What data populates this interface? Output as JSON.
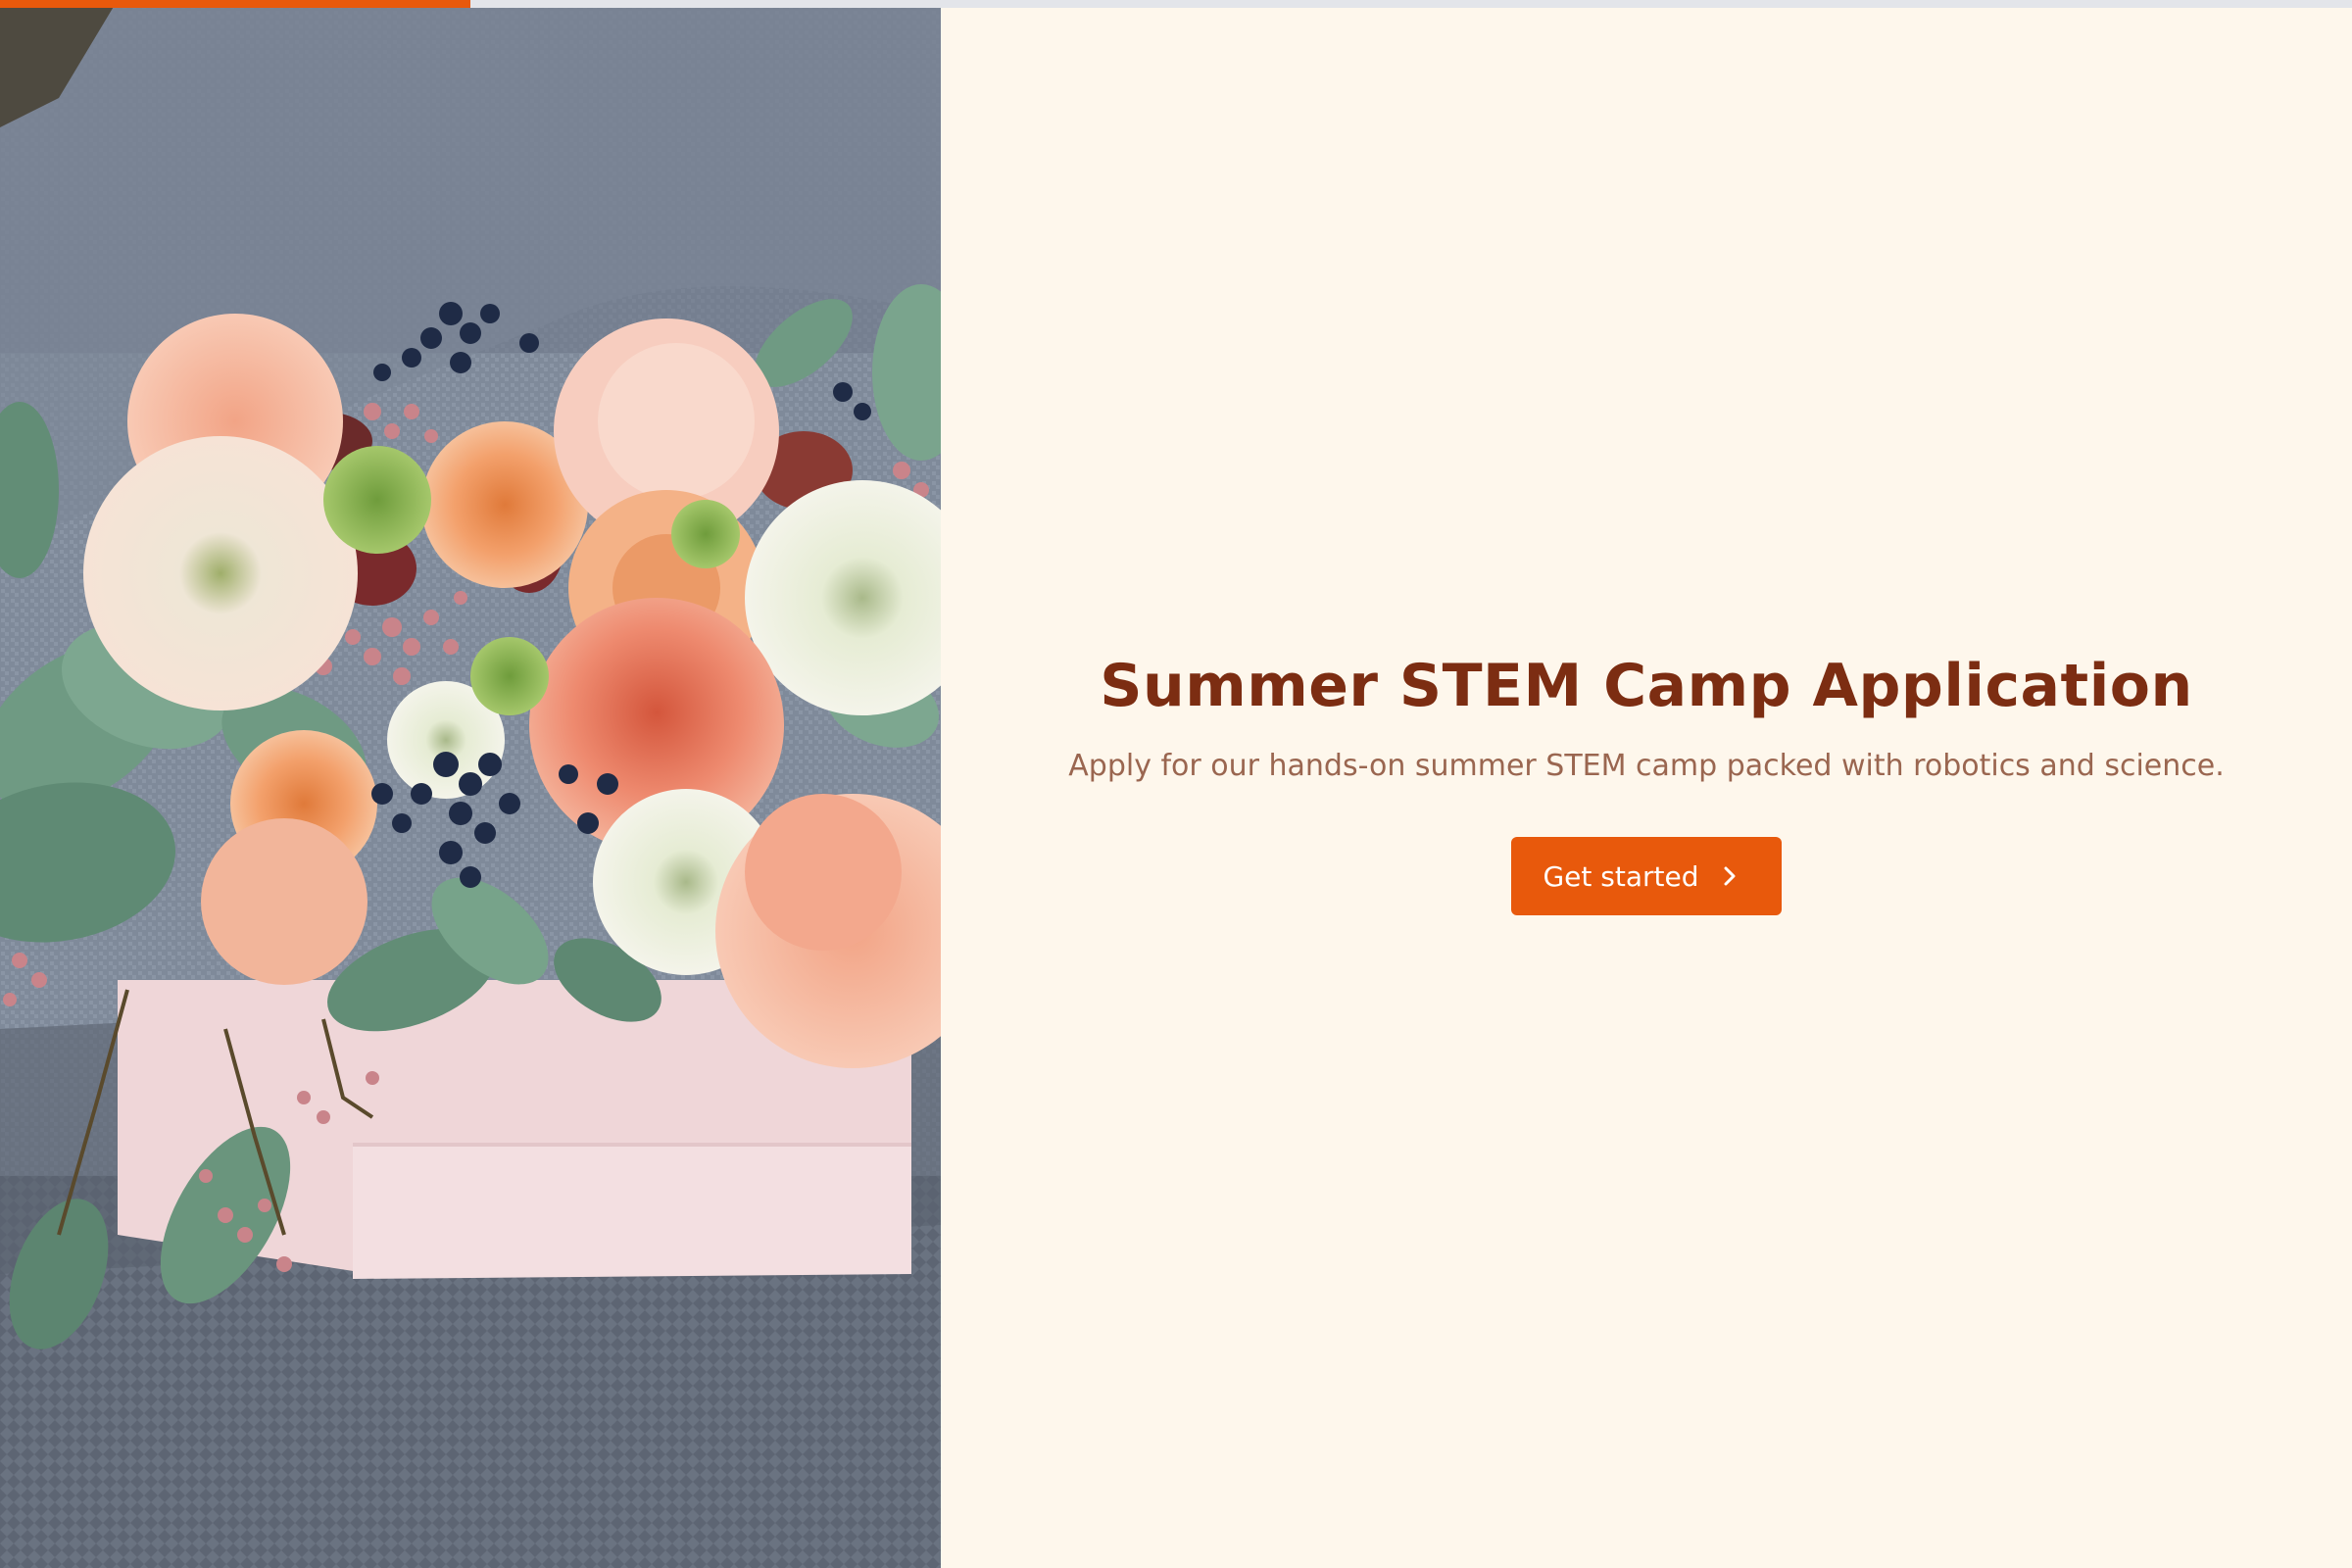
{
  "progress": {
    "fraction": 0.2
  },
  "hero_image": {
    "alt": "Flower arrangement in a pink box"
  },
  "intro": {
    "title": "Summer STEM Camp Application",
    "description": "Apply for our hands-on summer STEM camp packed with robotics and science.",
    "start_button_label": "Get started",
    "start_button_icon": "chevron-right-icon"
  },
  "colors": {
    "accent": "#e8590c",
    "title": "#7c2d12",
    "subtitle": "#9a6650",
    "background": "#fef7ec",
    "progress_track": "#e3e5ea"
  }
}
